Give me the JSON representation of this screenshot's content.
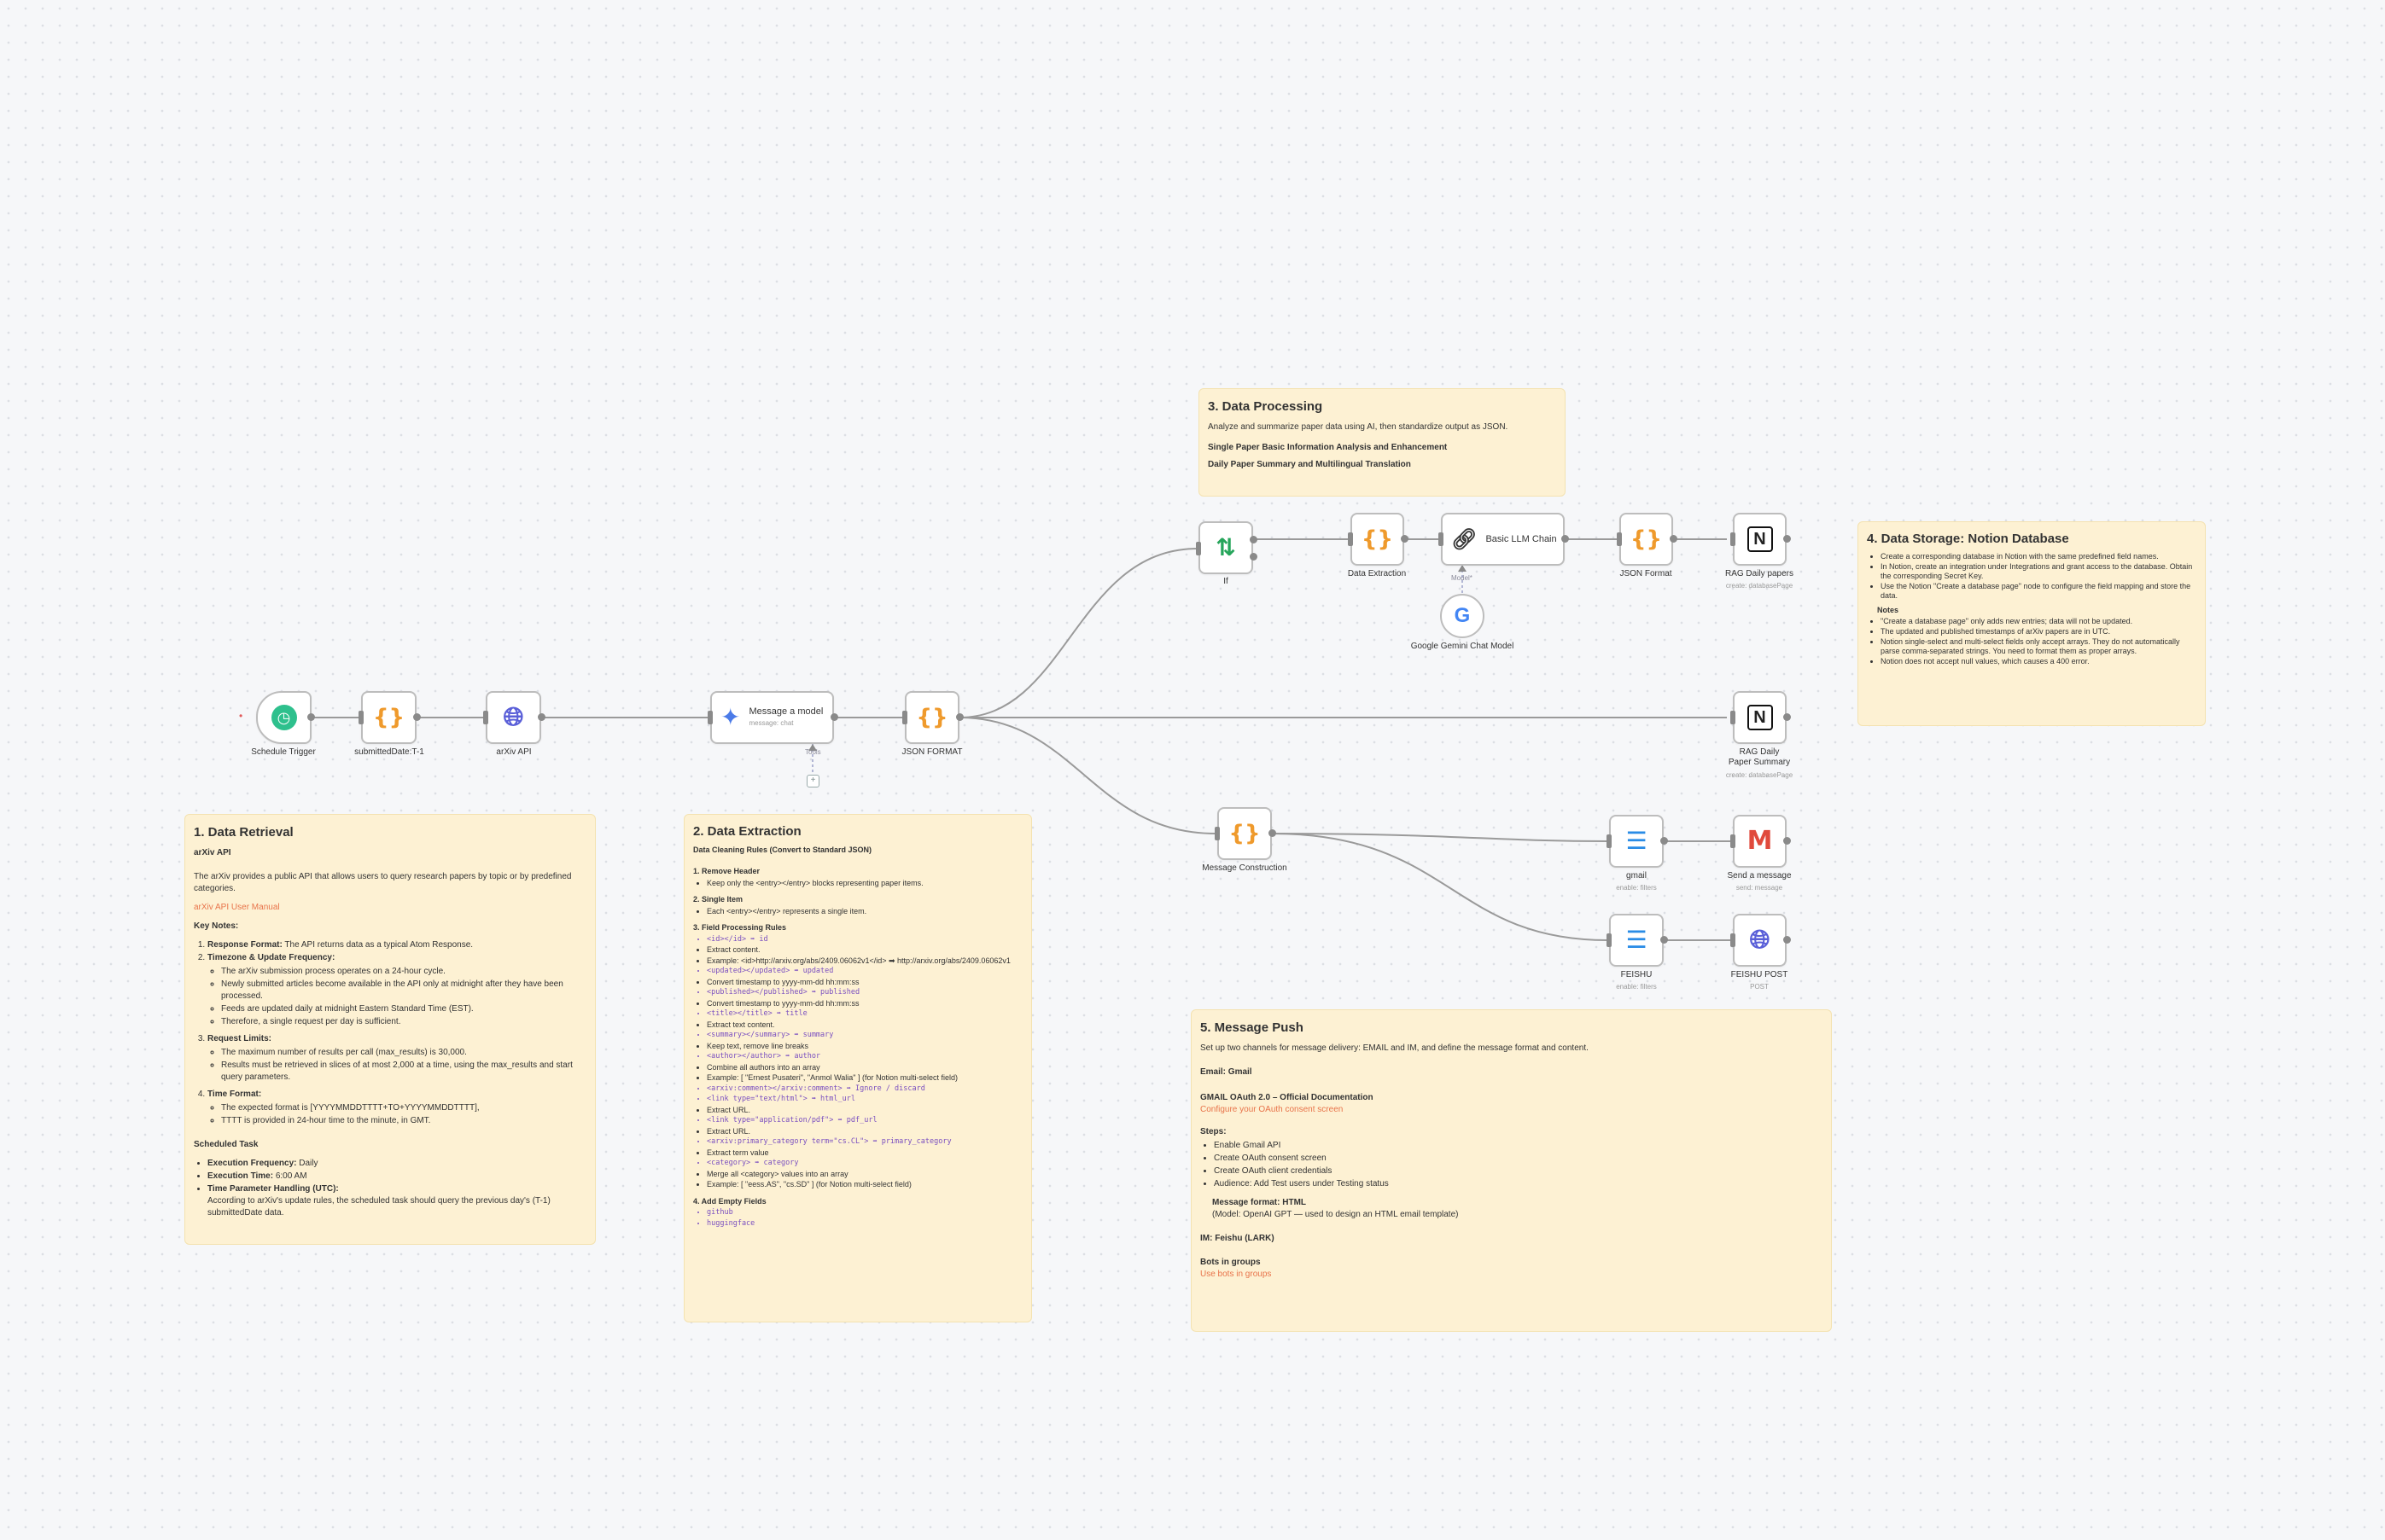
{
  "notes": {
    "retrieval": {
      "title": "1. Data Retrieval",
      "subtitle": "arXiv API",
      "intro": "The arXiv provides a public API that allows users to query research papers by topic or by predefined categories.",
      "link": "arXiv API User Manual",
      "key_notes_title": "Key Notes:",
      "points": [
        {
          "head": "Response Format:",
          "text": "The API returns data as a typical Atom Response."
        },
        {
          "head": "Timezone & Update Frequency:",
          "items": [
            "The arXiv submission process operates on a 24-hour cycle.",
            "Newly submitted articles become available in the API only at midnight after they have been processed.",
            "Feeds are updated daily at midnight Eastern Standard Time (EST).",
            "Therefore, a single request per day is sufficient."
          ]
        },
        {
          "head": "Request Limits:",
          "items": [
            "The maximum number of results per call (max_results) is 30,000.",
            "Results must be retrieved in slices of at most 2,000 at a time, using the max_results and start query parameters."
          ]
        },
        {
          "head": "Time Format:",
          "items": [
            "The expected format is [YYYYMMDDTTTT+TO+YYYYMMDDTTTT],",
            "TTTT is provided in 24-hour time to the minute, in GMT."
          ]
        }
      ],
      "scheduled_title": "Scheduled Task",
      "scheduled": [
        {
          "head": "Execution Frequency:",
          "text": "Daily"
        },
        {
          "head": "Execution Time:",
          "text": "6:00 AM"
        },
        {
          "head": "Time Parameter Handling (UTC):",
          "text": "According to arXiv's update rules, the scheduled task should query the previous day's (T-1) submittedDate data."
        }
      ]
    },
    "extraction": {
      "title": "2. Data Extraction",
      "subtitle": "Data Cleaning Rules (Convert to Standard JSON)",
      "sections": [
        {
          "head": "1. Remove Header",
          "lines": [
            "Keep only the <entry></entry> blocks representing paper items."
          ]
        },
        {
          "head": "2. Single Item",
          "lines": [
            "Each <entry></entry> represents a single item."
          ]
        },
        {
          "head": "3. Field Processing Rules",
          "lines": [
            "<id></id> ➡ id",
            "Extract content.",
            "Example: <id>http://arxiv.org/abs/2409.06062v1</id> ➡ http://arxiv.org/abs/2409.06062v1",
            "<updated></updated> ➡ updated",
            "Convert timestamp to yyyy-mm-dd hh:mm:ss",
            "<published></published> ➡ published",
            "Convert timestamp to yyyy-mm-dd hh:mm:ss",
            "<title></title> ➡ title",
            "Extract text content.",
            "<summary></summary> ➡ summary",
            "Keep text, remove line breaks",
            "<author></author> ➡ author",
            "Combine all authors into an array",
            "Example: [ \"Ernest Pusateri\", \"Anmol Walia\" ] (for Notion multi-select field)",
            "<arxiv:comment></arxiv:comment> ➡ Ignore / discard",
            "<link type=\"text/html\"> ➡ html_url",
            "Extract URL.",
            "<link type=\"application/pdf\"> ➡ pdf_url",
            "Extract URL.",
            "<arxiv:primary_category term=\"cs.CL\"> ➡ primary_category",
            "Extract term value",
            "<category> ➡ category",
            "Merge all <category> values into an array",
            "Example: [ \"eess.AS\", \"cs.SD\" ] (for Notion multi-select field)"
          ]
        },
        {
          "head": "4. Add Empty Fields",
          "lines": [
            "github",
            "huggingface"
          ]
        }
      ]
    },
    "processing": {
      "title": "3. Data Processing",
      "intro": "Analyze and summarize paper data using AI, then standardize output as JSON.",
      "lines": [
        "Single Paper Basic Information Analysis and Enhancement",
        "Daily Paper Summary and Multilingual Translation"
      ]
    },
    "storage": {
      "title": "4. Data Storage: Notion Database",
      "items": [
        "Create a corresponding database in Notion with the same predefined field names.",
        "In Notion, create an integration under Integrations and grant access to the database. Obtain the corresponding Secret Key.",
        "Use the Notion \"Create a database page\" node to configure the field mapping and store the data."
      ],
      "notes_title": "Notes",
      "notes": [
        "\"Create a database page\" only adds new entries; data will not be updated.",
        "The updated and published timestamps of arXiv papers are in UTC.",
        "Notion single-select and multi-select fields only accept arrays. They do not automatically parse comma-separated strings. You need to format them as proper arrays.",
        "Notion does not accept null values, which causes a 400 error."
      ]
    },
    "push": {
      "title": "5. Message Push",
      "intro": "Set up two channels for message delivery: EMAIL and IM, and define the message format and content.",
      "email_title": "Email: Gmail",
      "oauth_title": "GMAIL OAuth 2.0 – Official Documentation",
      "oauth_link": "Configure your OAuth consent screen",
      "steps_title": "Steps:",
      "steps": [
        "Enable Gmail API",
        "Create OAuth consent screen",
        "Create OAuth client credentials",
        "Audience: Add Test users under Testing status"
      ],
      "format_title": "Message format: HTML",
      "format_text": "(Model: OpenAI GPT — used to design an HTML email template)",
      "im_title": "IM: Feishu (LARK)",
      "bots_title": "Bots in groups",
      "bots_link": "Use bots in groups"
    }
  },
  "nodes": {
    "schedule": {
      "label": "Schedule Trigger",
      "icon": "clock-icon"
    },
    "submitted": {
      "label": "submittedDate:T-1",
      "icon": "code-braces-icon"
    },
    "arxiv": {
      "label": "arXiv API",
      "icon": "globe-icon"
    },
    "message_model": {
      "label": "Message a model",
      "sub": "message: chat",
      "icon": "gemini-icon",
      "tools_label": "Tools"
    },
    "json_format": {
      "label": "JSON FORMAT",
      "icon": "code-braces-icon"
    },
    "if": {
      "label": "If",
      "icon": "if-icon"
    },
    "data_extraction": {
      "label": "Data Extraction",
      "icon": "code-braces-icon"
    },
    "llm_chain": {
      "label": "Basic LLM Chain",
      "icon": "chain-icon",
      "model_label": "Model*"
    },
    "gemini": {
      "label": "Google Gemini Chat Model",
      "icon": "google-icon"
    },
    "json_format2": {
      "label": "JSON Format",
      "icon": "code-braces-icon"
    },
    "rag_daily": {
      "label": "RAG Daily papers",
      "sub": "create: databasePage",
      "icon": "notion-icon"
    },
    "rag_summary": {
      "label": "RAG Daily Paper Summary",
      "sub": "create: databasePage",
      "icon": "notion-icon"
    },
    "message_construction": {
      "label": "Message Construction",
      "icon": "code-braces-icon"
    },
    "gmail_filter": {
      "label": "gmail",
      "sub": "enable: filters",
      "icon": "filter-icon"
    },
    "send_message": {
      "label": "Send a message",
      "sub": "send: message",
      "icon": "gmail-icon"
    },
    "feishu_filter": {
      "label": "FEISHU",
      "sub": "enable: filters",
      "icon": "filter-icon"
    },
    "feishu_post": {
      "label": "FEISHU POST",
      "sub": "POST",
      "icon": "globe-icon"
    }
  },
  "colors": {
    "canvas": "#f6f7f9",
    "note": "#fdf1d3",
    "edge": "#8a8a8a",
    "brace": "#ef9a2c",
    "link": "#e8734a"
  }
}
